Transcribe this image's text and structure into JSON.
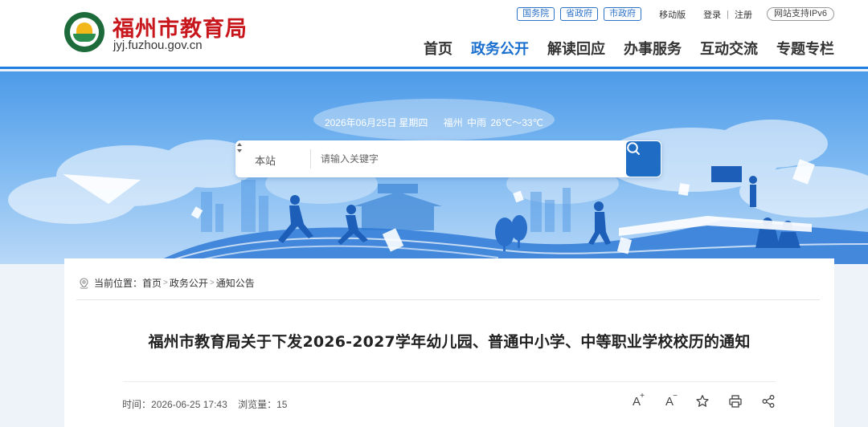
{
  "header": {
    "site_name": "福州市教育局",
    "domain_prefix": "jyj",
    "domain_suffix": ".fuzhou.gov.cn",
    "gov_links": [
      "国务院",
      "省政府",
      "市政府"
    ],
    "mobile_label": "移动版",
    "login_label": "登录",
    "register_label": "注册",
    "ipv6_label": "网站支持IPv6"
  },
  "nav": {
    "items": [
      "首页",
      "政务公开",
      "解读回应",
      "办事服务",
      "互动交流",
      "专题专栏"
    ],
    "active_index": 1
  },
  "banner": {
    "date": "2026年06月25日",
    "weekday": "星期四",
    "weather": "福州 中雨 26℃～33℃"
  },
  "search": {
    "scope": "本站",
    "placeholder": "请输入关键字"
  },
  "breadcrumb": {
    "prefix": "当前位置：",
    "items": [
      "首页",
      "政务公开",
      "通知公告"
    ],
    "separator": ">"
  },
  "article": {
    "title": "福州市教育局关于下发2026-2027学年幼儿园、普通中小学、中等职业学校校历的通知",
    "time_label": "时间：",
    "time": "2026-06-25 17:43",
    "views_label": "浏览量：",
    "views": "15"
  },
  "tools": {
    "font_up_glyph": "A",
    "font_down_glyph": "A",
    "icons": [
      "font-increase-icon",
      "font-decrease-icon",
      "star-icon",
      "print-icon",
      "share-icon"
    ]
  },
  "colors": {
    "brand_red": "#c8161d",
    "nav_active": "#1a6fcf",
    "search_button": "#1f6cc4"
  }
}
